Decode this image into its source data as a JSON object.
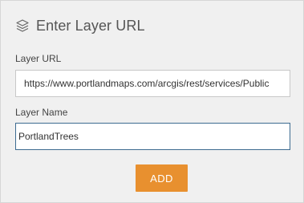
{
  "header": {
    "icon": "layers-icon",
    "title": "Enter Layer URL"
  },
  "form": {
    "url_label": "Layer URL",
    "url_value": "https://www.portlandmaps.com/arcgis/rest/services/Public",
    "name_label": "Layer Name",
    "name_value": "PortlandTrees"
  },
  "actions": {
    "add_label": "ADD"
  },
  "colors": {
    "panel_background": "#f0f0f0",
    "accent_button": "#e8902f",
    "focused_border": "#3d6b91"
  }
}
